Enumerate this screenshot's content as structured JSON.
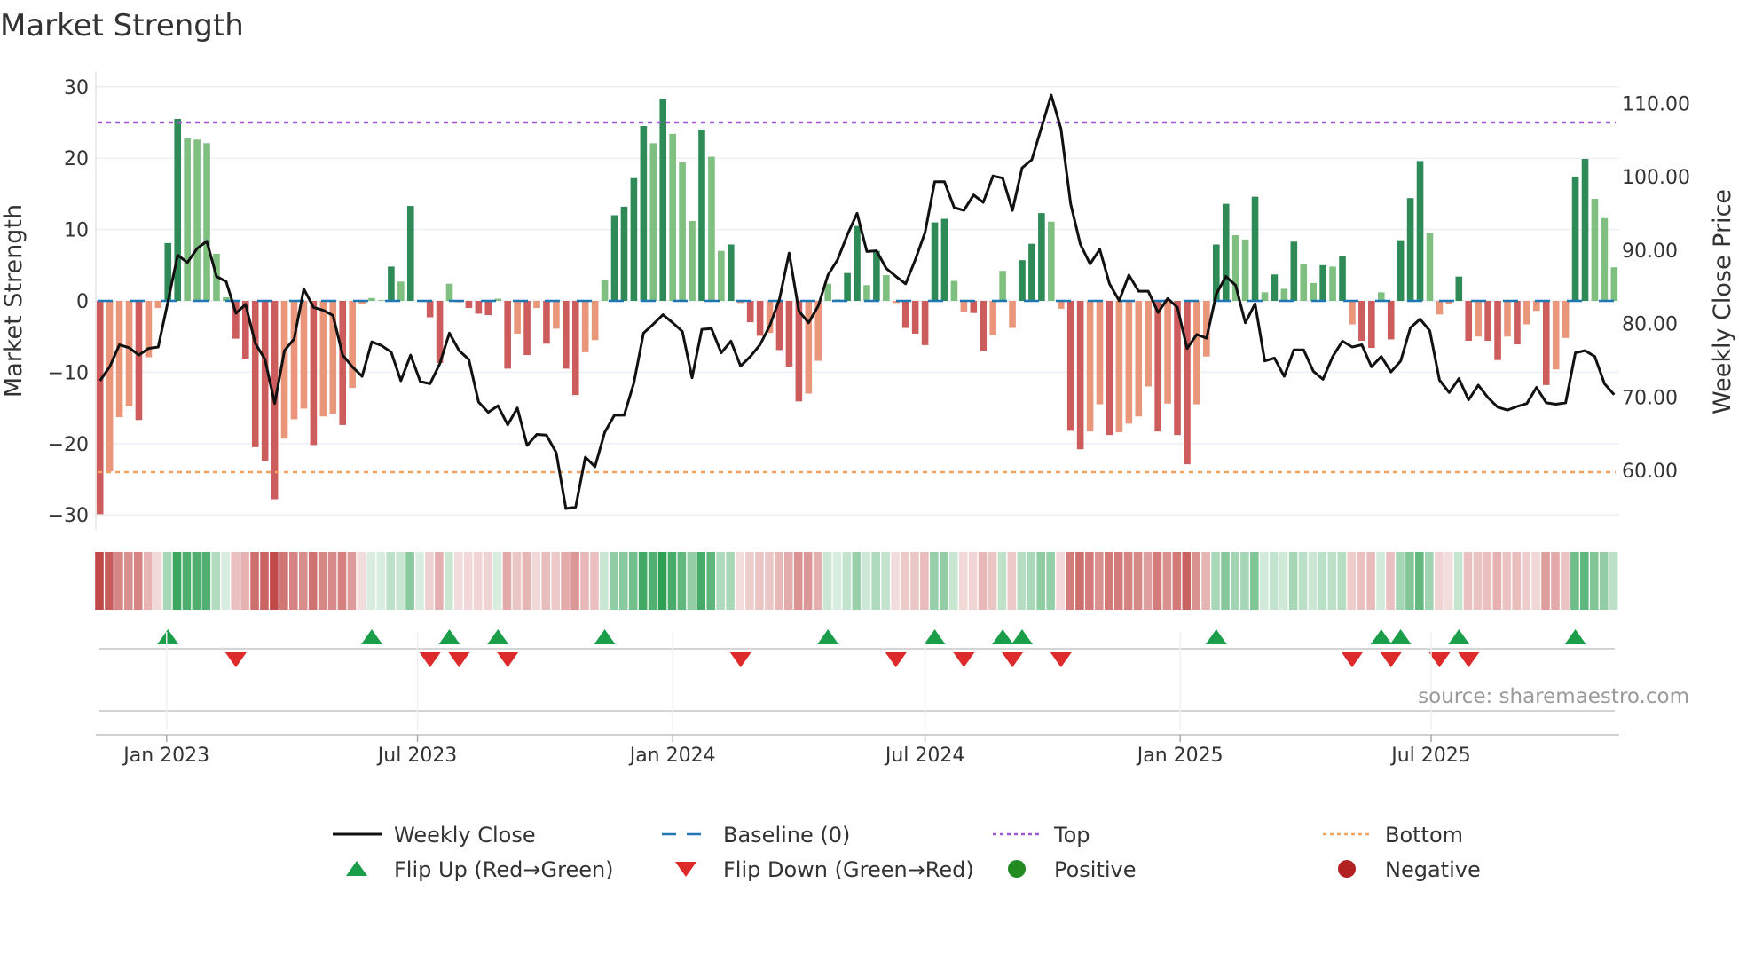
{
  "title": "Market Strength",
  "source": "source: sharemaestro.com",
  "colors": {
    "pos_strong": "#2e8b57",
    "pos_weak": "#7fbf7f",
    "neg_strong": "#cd5c5c",
    "neg_weak": "#e9967a",
    "baseline": "#1f77b4",
    "top": "#9b59d6",
    "bottom": "#f0a35e",
    "close": "#111111",
    "flip_up": "#1a9e4a",
    "flip_down": "#dd2a2a",
    "positive": "#228b22",
    "negative": "#b22222"
  },
  "legend": [
    {
      "key": "close",
      "label": "Weekly Close"
    },
    {
      "key": "baseline",
      "label": "Baseline (0)"
    },
    {
      "key": "top",
      "label": "Top"
    },
    {
      "key": "bottom",
      "label": "Bottom"
    },
    {
      "key": "flip_up",
      "label": "Flip Up (Red→Green)"
    },
    {
      "key": "flip_down",
      "label": "Flip Down (Green→Red)"
    },
    {
      "key": "positive",
      "label": "Positive"
    },
    {
      "key": "negative",
      "label": "Negative"
    }
  ],
  "chart_data": {
    "type": "bar",
    "title": "Market Strength",
    "ylabel": "Market Strength",
    "y2label": "Weekly Close Price",
    "ylim": [
      -32,
      32
    ],
    "y2lim": [
      55.5,
      112
    ],
    "yticks": [
      30,
      20,
      10,
      0,
      -10,
      -20,
      -30
    ],
    "ytick_labels": [
      "30",
      "20",
      "10",
      "0",
      "−10",
      "−20",
      "−30"
    ],
    "y2ticks": [
      110,
      100,
      90,
      80,
      70,
      60
    ],
    "y2tick_labels": [
      "110.00",
      "100.00",
      "90.00",
      "80.00",
      "70.00",
      "60.00"
    ],
    "x_tick_labels": [
      "Jan 2023",
      "Jul 2023",
      "Jan 2024",
      "Jul 2024",
      "Jan 2025",
      "Jul 2025"
    ],
    "x_tick_weeks": [
      6.86,
      32.71,
      59.0,
      85.0,
      111.29,
      137.14
    ],
    "top_level": 25,
    "bottom_level": -24,
    "baseline": 0,
    "grid": true,
    "legend_position": "bottom",
    "strength": [
      -29.9,
      -23.9,
      -16.3,
      -14.8,
      -16.7,
      -7.9,
      -1.0,
      8.1,
      25.5,
      22.8,
      22.6,
      22.1,
      6.6,
      0.5,
      -5.3,
      -8.1,
      -20.5,
      -22.5,
      -27.8,
      -19.3,
      -16.6,
      -15.1,
      -20.2,
      -16.2,
      -15.8,
      -17.4,
      -12.2,
      -0.5,
      0.4,
      0.1,
      4.8,
      2.7,
      13.3,
      0.1,
      -2.3,
      -8.7,
      2.4,
      -0.2,
      -1.0,
      -1.8,
      -2.0,
      0.3,
      -9.5,
      -4.6,
      -7.6,
      -1.0,
      -6.0,
      -3.9,
      -9.5,
      -13.2,
      -7.2,
      -5.5,
      2.9,
      12.0,
      13.2,
      17.2,
      24.5,
      22.1,
      28.3,
      23.4,
      19.4,
      11.2,
      24.0,
      20.2,
      7.0,
      7.9,
      -0.3,
      -3.0,
      -4.9,
      -4.5,
      -6.9,
      -9.2,
      -14.1,
      -13.0,
      -8.4,
      2.4,
      0.2,
      3.9,
      10.5,
      2.2,
      7.0,
      3.6,
      -0.3,
      -3.8,
      -4.6,
      -6.2,
      11.0,
      11.5,
      2.8,
      -1.5,
      -1.7,
      -7.0,
      -4.8,
      4.2,
      -3.8,
      5.7,
      8.0,
      12.3,
      11.1,
      -1.1,
      -18.2,
      -20.8,
      -18.3,
      -14.5,
      -18.8,
      -18.4,
      -17.2,
      -16.2,
      -12.0,
      -18.3,
      -14.4,
      -18.8,
      -22.9,
      -14.5,
      -7.8,
      7.9,
      13.6,
      9.2,
      8.6,
      14.6,
      1.2,
      3.7,
      1.7,
      8.3,
      5.1,
      2.5,
      5.0,
      4.8,
      6.3,
      -3.3,
      -5.6,
      -6.6,
      1.2,
      -5.4,
      8.5,
      14.4,
      19.6,
      9.5,
      -1.9,
      -0.5,
      3.4,
      -5.6,
      -5.0,
      -5.6,
      -8.3,
      -5.0,
      -6.1,
      -3.3,
      -1.4,
      -11.8,
      -9.6,
      -5.2,
      17.4,
      19.9,
      14.3,
      11.6,
      4.7
    ],
    "weekly_close": [
      72.2,
      74.1,
      77.1,
      76.7,
      75.7,
      76.6,
      76.8,
      83.0,
      89.3,
      88.3,
      90.2,
      91.2,
      86.4,
      85.7,
      81.4,
      82.6,
      77.3,
      75.1,
      69.1,
      76.3,
      77.9,
      84.7,
      82.2,
      81.8,
      81.1,
      75.7,
      74.1,
      72.8,
      77.5,
      77.0,
      76.1,
      72.2,
      75.7,
      72.1,
      71.8,
      74.5,
      78.7,
      76.3,
      75.1,
      69.3,
      67.9,
      68.8,
      66.2,
      68.5,
      63.4,
      64.9,
      64.8,
      62.4,
      54.8,
      55.0,
      61.8,
      60.5,
      65.2,
      67.5,
      67.5,
      71.9,
      78.7,
      79.9,
      81.2,
      80.1,
      78.9,
      72.6,
      79.2,
      79.3,
      76.0,
      77.6,
      74.2,
      75.5,
      77.1,
      79.7,
      83.3,
      89.6,
      81.7,
      80.1,
      82.4,
      86.6,
      88.7,
      92.1,
      95.0,
      89.8,
      89.9,
      87.5,
      86.4,
      85.4,
      88.7,
      92.4,
      99.3,
      99.3,
      95.8,
      95.4,
      97.5,
      96.5,
      100.1,
      99.8,
      95.4,
      101.2,
      102.3,
      106.7,
      111.1,
      106.5,
      96.3,
      90.8,
      88.1,
      90.1,
      85.4,
      83.1,
      86.6,
      84.4,
      84.4,
      81.5,
      83.4,
      82.2,
      76.6,
      78.5,
      78.0,
      84.0,
      86.4,
      85.2,
      80.1,
      82.7,
      74.9,
      75.3,
      72.8,
      76.4,
      76.4,
      73.5,
      72.4,
      75.5,
      77.6,
      76.8,
      77.1,
      74.1,
      75.5,
      73.4,
      74.9,
      79.4,
      80.6,
      79.0,
      72.3,
      70.6,
      72.5,
      69.6,
      71.6,
      69.9,
      68.6,
      68.2,
      68.7,
      69.1,
      71.3,
      69.2,
      69.0,
      69.2,
      76.0,
      76.3,
      75.5,
      71.8,
      70.3
    ],
    "flip_up_weeks": [
      8,
      29,
      37,
      42,
      53,
      76,
      87,
      94,
      96,
      116,
      133,
      135,
      141,
      153
    ],
    "flip_down_weeks": [
      15,
      35,
      38,
      43,
      67,
      83,
      90,
      95,
      100,
      130,
      134,
      139,
      142
    ]
  }
}
